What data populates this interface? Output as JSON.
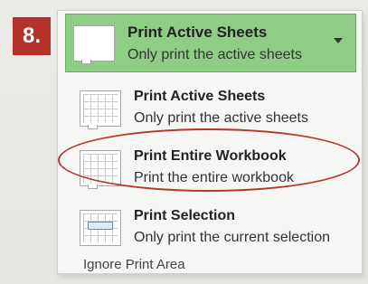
{
  "step_badge": "8.",
  "selector": {
    "title": "Print Active Sheets",
    "subtitle": "Only print the active sheets"
  },
  "menu": {
    "items": [
      {
        "title": "Print Active Sheets",
        "subtitle": "Only print the active sheets",
        "icon": "sheet-grid-icon"
      },
      {
        "title": "Print Entire Workbook",
        "subtitle": "Print the entire workbook",
        "icon": "workbook-grid-icon"
      },
      {
        "title": "Print Selection",
        "subtitle": "Only print the current selection",
        "icon": "selection-grid-icon"
      }
    ],
    "ignore_print_area": "Ignore Print Area"
  },
  "colors": {
    "badge": "#b5322c",
    "selector_bg": "#8fcc86",
    "annotation": "#b5382f"
  }
}
